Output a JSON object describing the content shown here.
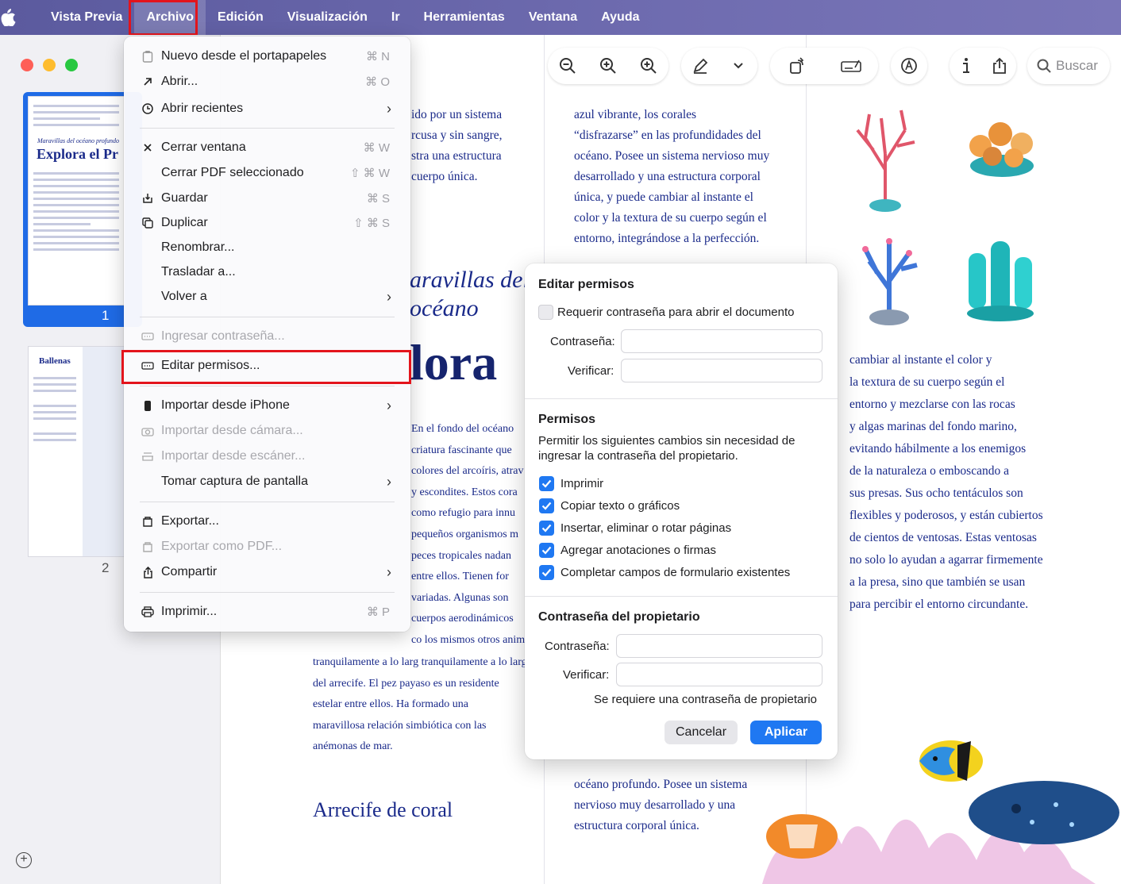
{
  "menubar": {
    "app_name": "Vista Previa",
    "items": [
      "Archivo",
      "Edición",
      "Visualización",
      "Ir",
      "Herramientas",
      "Ventana",
      "Ayuda"
    ]
  },
  "sidebar": {
    "thumb1": {
      "subtitle": "Maravillas del océano profundo",
      "title": "Explora el Pr",
      "page_number": "1"
    },
    "thumb2": {
      "title": "Ballenas",
      "page_number": "2"
    }
  },
  "toolbar": {
    "search_placeholder": "Buscar"
  },
  "file_menu": {
    "items": [
      {
        "label": "Nuevo desde el portapapeles",
        "shortcut": "⌘ N"
      },
      {
        "label": "Abrir...",
        "shortcut": "⌘ O"
      },
      {
        "label": "Abrir recientes"
      },
      {
        "label": "Cerrar ventana",
        "shortcut": "⌘ W"
      },
      {
        "label": "Cerrar PDF seleccionado",
        "shortcut": "⇧ ⌘ W"
      },
      {
        "label": "Guardar",
        "shortcut": "⌘ S"
      },
      {
        "label": "Duplicar",
        "shortcut": "⇧ ⌘ S"
      },
      {
        "label": "Renombrar..."
      },
      {
        "label": "Trasladar a..."
      },
      {
        "label": "Volver a"
      },
      {
        "label": "Ingresar contraseña..."
      },
      {
        "label": "Editar permisos..."
      },
      {
        "label": "Importar desde iPhone"
      },
      {
        "label": "Importar desde cámara..."
      },
      {
        "label": "Importar desde escáner..."
      },
      {
        "label": "Tomar captura de pantalla"
      },
      {
        "label": "Exportar..."
      },
      {
        "label": "Exportar como PDF..."
      },
      {
        "label": "Compartir"
      },
      {
        "label": "Imprimir...",
        "shortcut": "⌘ P"
      }
    ]
  },
  "document": {
    "col1_top": [
      "ido por un sistema",
      "rcusa y sin sangre,",
      "stra una estructura",
      "cuerpo única."
    ],
    "heading_ital_1": "aravillas del",
    "heading_ital_2": "océano",
    "heading_big": "lora",
    "col1_mid": [
      "En el fondo del océano",
      "criatura fascinante que",
      "colores del arcoíris, atrav",
      "y escondites. Estos cora",
      "como refugio para innu",
      "pequeños organismos m",
      "peces tropicales nadan",
      "entre ellos. Tienen for",
      "variadas. Algunas son",
      "cuerpos aerodinámicos",
      "co los mismos otros anim"
    ],
    "col1_bottom": [
      "tranquilamente a lo larg  tranquilamente a lo larg",
      "del arrecife. El pez payaso es un residente",
      "estelar entre ellos. Ha formado una",
      "maravillosa relación simbiótica con las",
      "anémonas de mar."
    ],
    "section_heading": "Arrecife de coral",
    "col2_top": [
      "azul vibrante, los corales",
      "“disfrazarse” en las profundidades del",
      "océano. Posee un sistema nervioso muy",
      "desarrollado y una estructura corporal",
      "única, y puede cambiar al instante el",
      "color y la textura de su cuerpo según el",
      "entorno, integrándose a la perfección."
    ],
    "col2_bottom": [
      "océano profundo. Posee un sistema",
      "nervioso muy desarrollado y una",
      "estructura corporal única."
    ],
    "col3": [
      "cambiar al instante el color y",
      "la textura de su cuerpo según el",
      "entorno y mezclarse con las rocas",
      "y algas marinas del fondo marino,",
      "evitando hábilmente a los enemigos",
      "de la naturaleza o emboscando a",
      "sus presas. Sus ocho tentáculos son",
      "flexibles y poderosos, y están cubiertos",
      "de cientos de ventosas. Estas ventosas",
      "no solo lo ayudan a agarrar firmemente",
      "a la presa, sino que también se usan",
      "para percibir el entorno circundante."
    ]
  },
  "dialog": {
    "title": "Editar permisos",
    "require_open_label": "Requerir contraseña para abrir el documento",
    "require_open_checked": false,
    "password_label": "Contraseña:",
    "verify_label": "Verificar:",
    "permissions_title": "Permisos",
    "permissions_desc_1": "Permitir los siguientes cambios sin necesidad de",
    "permissions_desc_2": "ingresar la contraseña del propietario.",
    "permissions": [
      {
        "label": "Imprimir",
        "checked": true
      },
      {
        "label": "Copiar texto o gráficos",
        "checked": true
      },
      {
        "label": "Insertar, eliminar o rotar páginas",
        "checked": true
      },
      {
        "label": "Agregar anotaciones o firmas",
        "checked": true
      },
      {
        "label": "Completar campos de formulario existentes",
        "checked": true
      }
    ],
    "owner_title": "Contraseña del propietario",
    "owner_password_label": "Contraseña:",
    "owner_verify_label": "Verificar:",
    "owner_required_note": "Se requiere una contraseña de propietario",
    "cancel_label": "Cancelar",
    "apply_label": "Aplicar"
  },
  "colors": {
    "menubar": "#5b5a9e",
    "accent": "#1f78f2",
    "highlight": "#e3141c",
    "doc_text": "#1a2a8a"
  }
}
